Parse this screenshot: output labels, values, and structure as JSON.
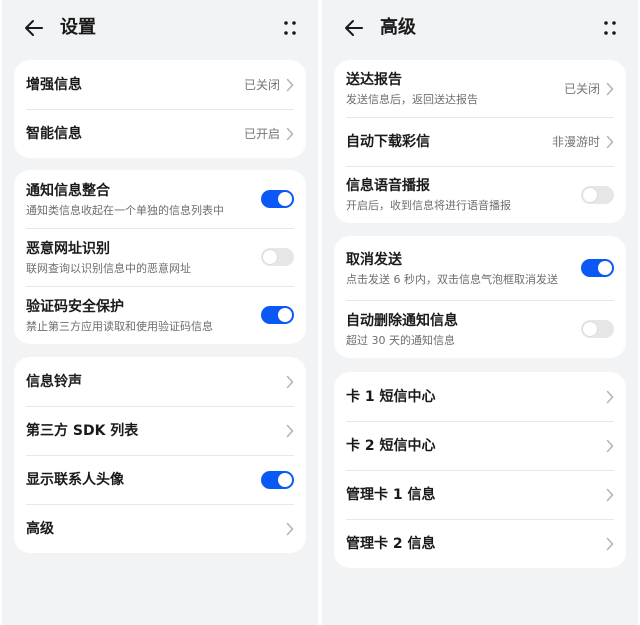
{
  "left": {
    "title": "设置",
    "group1": [
      {
        "label": "增强信息",
        "value": "已关闭"
      },
      {
        "label": "智能信息",
        "value": "已开启"
      }
    ],
    "group2": [
      {
        "label": "通知信息整合",
        "desc": "通知类信息收起在一个单独的信息列表中",
        "toggle": "on"
      },
      {
        "label": "恶意网址识别",
        "desc": "联网查询以识别信息中的恶意网址",
        "toggle": "off"
      },
      {
        "label": "验证码安全保护",
        "desc": "禁止第三方应用读取和使用验证码信息",
        "toggle": "on"
      }
    ],
    "group3": [
      {
        "label": "信息铃声"
      },
      {
        "label": "第三方 SDK 列表"
      },
      {
        "label": "显示联系人头像",
        "toggle": "on"
      },
      {
        "label": "高级"
      }
    ]
  },
  "right": {
    "title": "高级",
    "group1": [
      {
        "label": "送达报告",
        "desc": "发送信息后，返回送达报告",
        "value": "已关闭"
      },
      {
        "label": "自动下载彩信",
        "value": "非漫游时"
      },
      {
        "label": "信息语音播报",
        "desc": "开启后，收到信息将进行语音播报",
        "toggle": "off"
      }
    ],
    "group2": [
      {
        "label": "取消发送",
        "desc": "点击发送 6 秒内，双击信息气泡框取消发送",
        "toggle": "on"
      },
      {
        "label": "自动删除通知信息",
        "desc": "超过 30 天的通知信息",
        "toggle": "off"
      }
    ],
    "group3": [
      {
        "label": "卡 1 短信中心"
      },
      {
        "label": "卡 2 短信中心"
      },
      {
        "label": "管理卡 1 信息"
      },
      {
        "label": "管理卡 2 信息"
      }
    ]
  },
  "colors": {
    "accent": "#0a59f7",
    "background": "#f1f3f5",
    "card": "#ffffff",
    "toggle_off": "#e6e6e6"
  },
  "icons": {
    "back": "back-arrow-icon",
    "more": "more-dots-icon",
    "chevron": "chevron-right-icon"
  }
}
